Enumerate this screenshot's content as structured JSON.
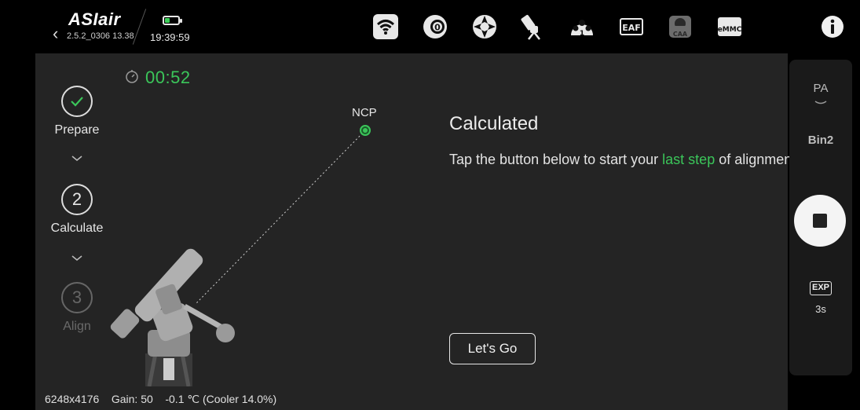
{
  "topbar": {
    "logo": "ASIair",
    "version": "2.5.2_0306 13.38",
    "clock": "19:39:59",
    "battery_level": 0.35,
    "status_icons": [
      "wifi-icon",
      "camera-cooler-icon",
      "guide-scope-icon",
      "mount-icon",
      "filter-wheel-icon",
      "eaf-focuser-icon",
      "caa-rotator-icon",
      "emmc-storage-icon",
      "info-icon"
    ],
    "status_icon_text": {
      "filter_wheel_number": "1",
      "eaf": "EAF",
      "caa": "CAA",
      "emmc": "eMMC",
      "camera_number": "0"
    }
  },
  "timer": "00:52",
  "steps": [
    {
      "number": "",
      "label": "Prepare",
      "state": "done"
    },
    {
      "number": "2",
      "label": "Calculate",
      "state": "active"
    },
    {
      "number": "3",
      "label": "Align",
      "state": "pending"
    }
  ],
  "ncp_label": "NCP",
  "panel": {
    "title": "Calculated",
    "desc_before": "Tap the button below to start your ",
    "desc_highlight": "last step",
    "desc_after": " of alignment",
    "button": "Let's Go"
  },
  "bottom": {
    "resolution": "6248x4176",
    "gain": "Gain: 50",
    "temp": "-0.1 ℃ (Cooler 14.0%)"
  },
  "right_panel": {
    "mode": "PA",
    "bin": "Bin2",
    "exp_label": "EXP",
    "exp_value": "3s"
  },
  "colors": {
    "accent_green": "#3bc65a",
    "panel_bg": "#242424",
    "sidebar_bg": "#1a1a1a"
  }
}
